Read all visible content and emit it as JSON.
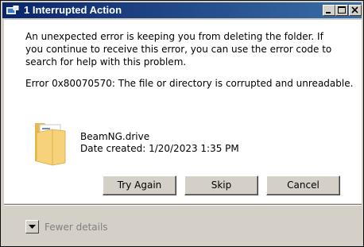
{
  "window": {
    "title": "1 Interrupted Action",
    "controls": [
      "minimize-icon",
      "maximize-icon",
      "close-icon"
    ]
  },
  "message": {
    "text": "An unexpected error is keeping you from deleting the folder. If you continue to receive this error, you can use the error code to search for help with this problem.",
    "error": "Error 0x80070570: The file or directory is corrupted and unreadable."
  },
  "item": {
    "icon": "folder-icon",
    "name": "BeamNG.drive",
    "date_created": "Date created: 1/20/2023 1:35 PM"
  },
  "buttons": {
    "try_again": "Try Again",
    "skip": "Skip",
    "cancel": "Cancel"
  },
  "footer": {
    "details_label": "Fewer details",
    "toggle_icon": "chevron-down-icon"
  },
  "colors": {
    "titlebar_start": "#0a246a",
    "titlebar_end": "#3a6ea5",
    "face": "#d4d0c8",
    "folder": "#f2c55a"
  }
}
